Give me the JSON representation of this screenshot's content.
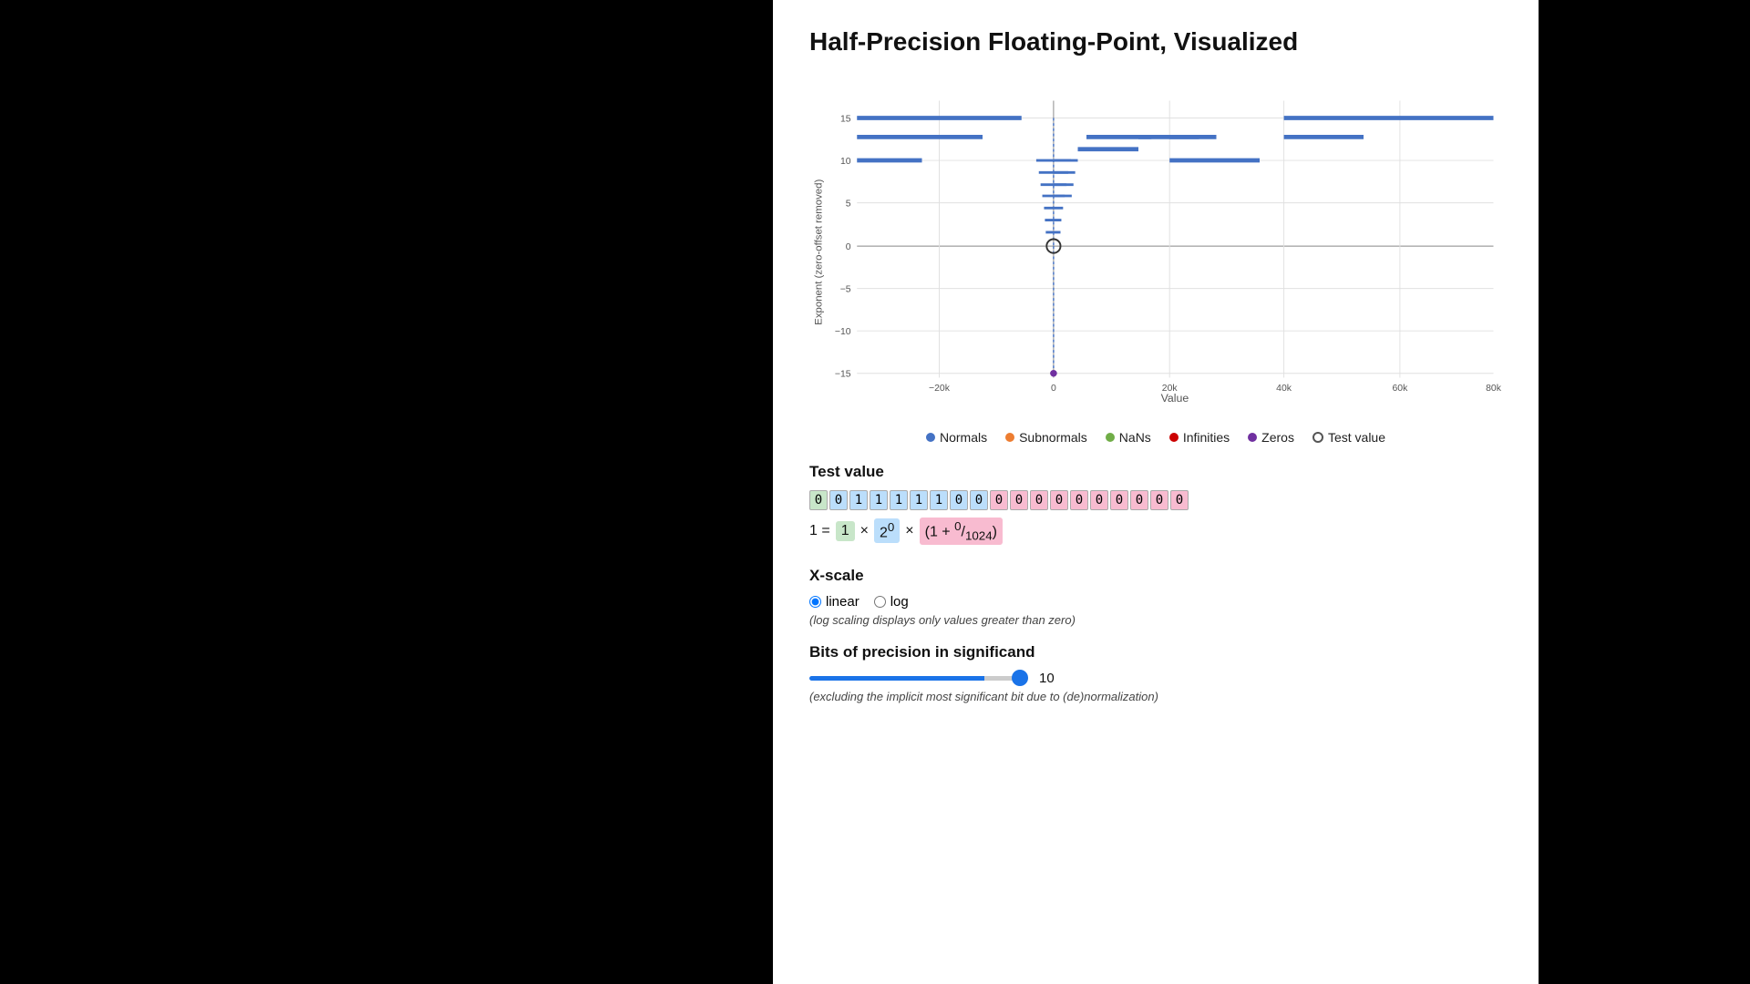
{
  "page": {
    "title": "Half-Precision Floating-Point, Visualized",
    "background": "#000",
    "content_bg": "#fff"
  },
  "chart": {
    "x_axis_label": "Value",
    "y_axis_label": "Exponent (zero-offset removed)",
    "x_ticks": [
      "-20k",
      "0",
      "20k",
      "40k",
      "60k",
      "80k"
    ],
    "y_ticks": [
      "15",
      "10",
      "5",
      "0",
      "-5",
      "-10",
      "-15"
    ]
  },
  "legend": {
    "items": [
      {
        "label": "Normals",
        "color": "#4472c4",
        "type": "dot"
      },
      {
        "label": "Subnormals",
        "color": "#ed7d31",
        "type": "dot"
      },
      {
        "label": "NaNs",
        "color": "#70ad47",
        "type": "dot"
      },
      {
        "label": "Infinities",
        "color": "#cc0000",
        "type": "dot"
      },
      {
        "label": "Zeros",
        "color": "#7030a0",
        "type": "dot"
      },
      {
        "label": "Test value",
        "color": "#555",
        "type": "circle"
      }
    ]
  },
  "test_value_section": {
    "title": "Test value",
    "formula_text": "1 =",
    "sign_value": "1",
    "exp_value": "2⁰",
    "mant_value": "(1 + 0/1024)",
    "bits_sign": [
      "0"
    ],
    "bits_exp": [
      "0",
      "1",
      "1",
      "1",
      "1",
      "1",
      "0",
      "0"
    ],
    "bits_mant": [
      "0",
      "0",
      "0",
      "0",
      "0",
      "0",
      "0",
      "0",
      "0",
      "0"
    ]
  },
  "xscale_section": {
    "title": "X-scale",
    "linear_label": "linear",
    "log_label": "log",
    "hint": "(log scaling displays only values greater than zero)"
  },
  "precision_section": {
    "title": "Bits of precision in significand",
    "value": "10",
    "slider_min": "1",
    "slider_max": "10",
    "slider_current": "10",
    "hint": "(excluding the implicit most significant bit due to (de)normalization)"
  }
}
